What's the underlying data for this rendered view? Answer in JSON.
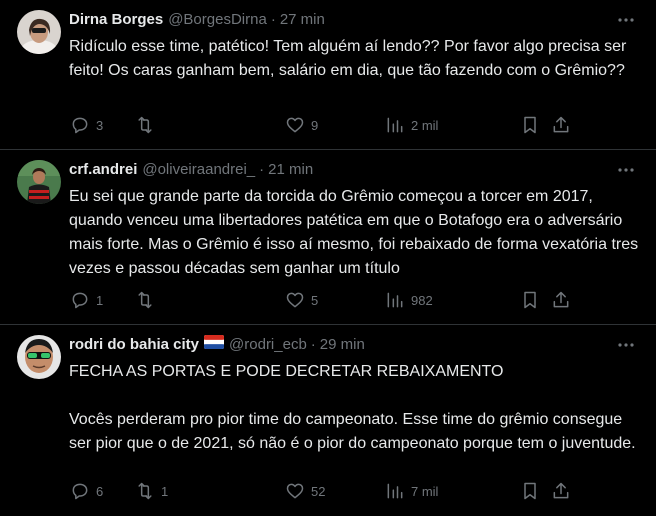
{
  "tweets": [
    {
      "name": "Dirna Borges",
      "handle": "@BorgesDirna",
      "time": "27 min",
      "text": "Ridículo esse time, patético! Tem alguém aí lendo?? Por favor algo precisa ser feito! Os caras ganham bem, salário em dia, que tão fazendo com o Grêmio??",
      "replies": "3",
      "retweets": "",
      "likes": "9",
      "views": "2 mil"
    },
    {
      "name": "crf.andrei",
      "handle": "@oliveiraandrei_",
      "time": "21 min",
      "text": "Eu sei que grande parte da torcida do Grêmio começou a torcer em 2017, quando venceu uma libertadores patética em que o Botafogo era o adversário mais forte. Mas o Grêmio é isso aí mesmo, foi rebaixado de forma vexatória tres vezes e passou décadas sem ganhar um título",
      "replies": "1",
      "retweets": "",
      "likes": "5",
      "views": "982"
    },
    {
      "name": "rodri do bahia city",
      "handle": "@rodri_ecb",
      "time": "29 min",
      "text": "FECHA AS PORTAS E PODE DECRETAR REBAIXAMENTO\n\nVocês perderam pro pior time do campeonato. Esse time do grêmio consegue ser pior que o de 2021, só não é o pior do campeonato porque tem o juventude.",
      "replies": "6",
      "retweets": "1",
      "likes": "52",
      "views": "7 mil"
    }
  ],
  "separator": "·",
  "icons": {
    "reply": "reply-icon",
    "retweet": "retweet-icon",
    "like": "heart-icon",
    "views": "views-chart-icon",
    "bookmark": "bookmark-icon",
    "share": "share-icon",
    "more": "more-icon"
  },
  "colors": {
    "background": "#000000",
    "text": "#e7e9ea",
    "muted": "#71767b",
    "divider": "#2f3336"
  }
}
